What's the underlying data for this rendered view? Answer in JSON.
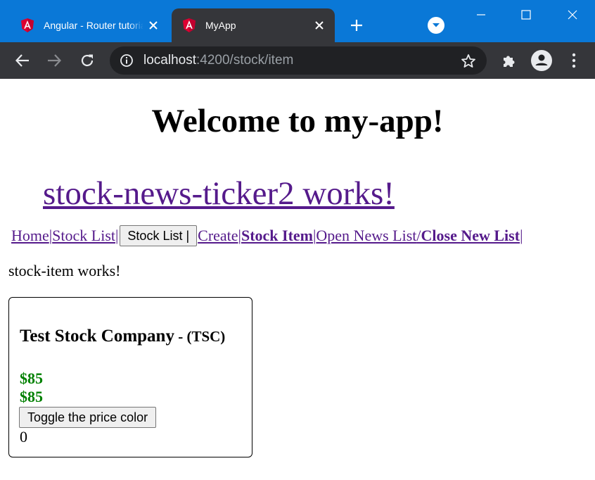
{
  "browser": {
    "tabs": [
      {
        "title": "Angular - Router tutorial",
        "favicon": "angular-icon",
        "active": false
      },
      {
        "title": "MyApp",
        "favicon": "angular-icon",
        "active": true
      }
    ],
    "address": {
      "host": "localhost",
      "path": ":4200/stock/item"
    },
    "colors": {
      "tabstrip": "#0a78d7",
      "toolbar": "#35363a",
      "omnibox": "#202124"
    }
  },
  "page": {
    "title": "Welcome to my-app!",
    "ticker_link": "stock-news-ticker2 works!",
    "nav": {
      "home": "Home ",
      "sep1": "|",
      "stock_list_link": " Stock List ",
      "sep2": "| ",
      "stock_list_button": "Stock List |",
      "create": "Create ",
      "sep3": "| ",
      "stock_item": "Stock Item ",
      "sep4": "|",
      "open_news": "Open News List ",
      "slash": "/ ",
      "close_news": "Close New List ",
      "sep5": "|"
    },
    "stock_item_text": "stock-item works!",
    "card": {
      "company_name": "Test Stock Company",
      "company_code": " - (TSC)",
      "price1": "$85",
      "price2": "$85",
      "toggle_label": "Toggle the price color",
      "counter": "0",
      "price_color": "#008000"
    },
    "link_color": "#551a8b"
  }
}
